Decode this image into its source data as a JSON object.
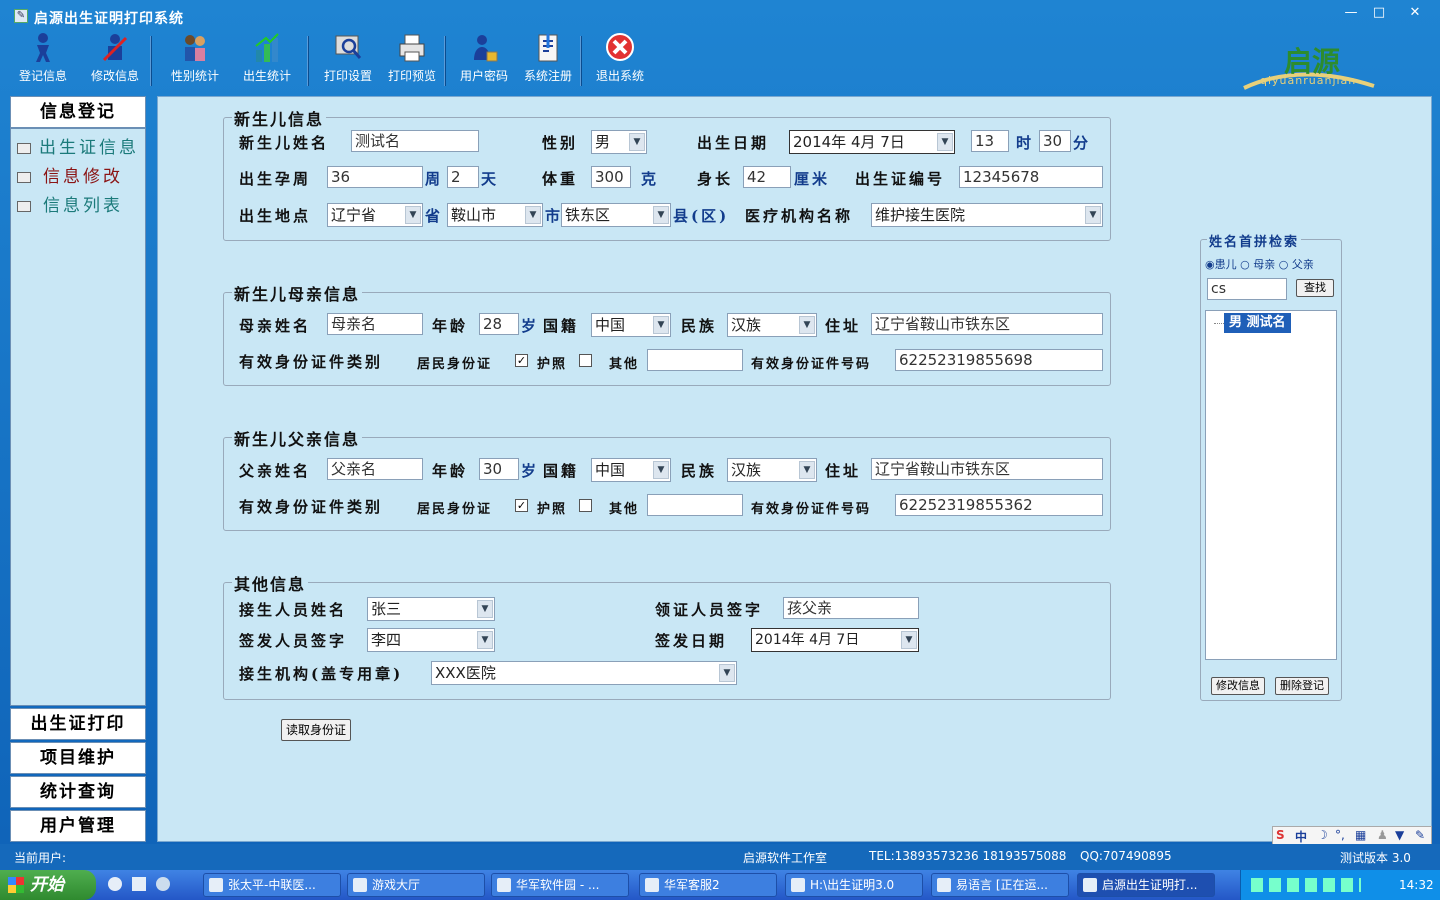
{
  "window": {
    "title": "启源出生证明打印系统",
    "title_icon": "app-icon"
  },
  "toolbar": [
    {
      "label": "登记信息",
      "icon": "register-person-icon"
    },
    {
      "label": "修改信息",
      "icon": "edit-person-icon"
    },
    {
      "label": "性别统计",
      "icon": "gender-stats-icon"
    },
    {
      "label": "出生统计",
      "icon": "birth-stats-icon"
    },
    {
      "label": "打印设置",
      "icon": "print-settings-icon"
    },
    {
      "label": "打印预览",
      "icon": "print-preview-icon"
    },
    {
      "label": "用户密码",
      "icon": "user-password-icon"
    },
    {
      "label": "系统注册",
      "icon": "system-register-icon"
    },
    {
      "label": "退出系统",
      "icon": "exit-icon"
    }
  ],
  "logo": {
    "text": "启源",
    "sub": "qiyuanruanjian"
  },
  "sidebar": {
    "head": "信息登记",
    "items": [
      {
        "label": "出生证信息",
        "color": "#1b7a7a"
      },
      {
        "label": "信息修改",
        "color": "#8b1414"
      },
      {
        "label": "信息列表",
        "color": "#1b7a7a"
      }
    ],
    "bottom": [
      "出生证打印",
      "项目维护",
      "统计查询",
      "用户管理"
    ]
  },
  "baby": {
    "section": "新生儿信息",
    "name_label": "新生儿姓名",
    "name": "测试名",
    "gender_label": "性别",
    "gender": "男",
    "dob_label": "出生日期",
    "dob": "2014年  4月  7日",
    "hour": "13",
    "hour_unit": "时",
    "minute": "30",
    "minute_unit": "分",
    "week_label": "出生孕周",
    "weeks": "36",
    "week_unit": "周",
    "days": "2",
    "day_unit": "天",
    "weight_label": "体重",
    "weight": "300",
    "weight_unit": "克",
    "length_label": "身长",
    "length": "42",
    "length_unit": "厘米",
    "cert_label": "出生证编号",
    "cert_no": "12345678",
    "place_label": "出生地点",
    "province": "辽宁省",
    "province_unit": "省",
    "city": "鞍山市",
    "city_unit": "市",
    "county": "铁东区",
    "county_unit": "县(区)",
    "hospital_label": "医疗机构名称",
    "hospital": "维护接生医院"
  },
  "mother": {
    "section": "新生儿母亲信息",
    "name_label": "母亲姓名",
    "name": "母亲名",
    "age_label": "年龄",
    "age": "28",
    "age_unit": "岁",
    "nation_label": "国籍",
    "nation": "中国",
    "ethnic_label": "民族",
    "ethnic": "汉族",
    "addr_label": "住址",
    "addr": "辽宁省鞍山市铁东区",
    "idtype_label": "有效身份证件类别",
    "id_resident": "居民身份证",
    "id_passport": "护照",
    "id_other": "其他",
    "idno_label": "有效身份证件号码",
    "idno": "62252319855698"
  },
  "father": {
    "section": "新生儿父亲信息",
    "name_label": "父亲姓名",
    "name": "父亲名",
    "age_label": "年龄",
    "age": "30",
    "age_unit": "岁",
    "nation_label": "国籍",
    "nation": "中国",
    "ethnic_label": "民族",
    "ethnic": "汉族",
    "addr_label": "住址",
    "addr": "辽宁省鞍山市铁东区",
    "idtype_label": "有效身份证件类别",
    "id_resident": "居民身份证",
    "id_passport": "护照",
    "id_other": "其他",
    "idno_label": "有效身份证件号码",
    "idno": "62252319855362"
  },
  "other": {
    "section": "其他信息",
    "midwife_label": "接生人员姓名",
    "midwife": "张三",
    "receiver_label": "领证人员签字",
    "receiver": "孩父亲",
    "issuer_label": "签发人员签字",
    "issuer": "李四",
    "issue_date_label": "签发日期",
    "issue_date": "2014年  4月  7日",
    "org_label": "接生机构(盖专用章)",
    "org": "XXX医院"
  },
  "read_id_button": "读取身份证",
  "search": {
    "title": "姓名首拼检索",
    "radio_child": "患儿",
    "radio_mother": "母亲",
    "radio_father": "父亲",
    "query": "cs",
    "find_button": "查找",
    "result": "男  测试名",
    "edit_button": "修改信息",
    "delete_button": "删除登记"
  },
  "status": {
    "user": "当前用户:",
    "studio": "启源软件工作室",
    "tel": "TEL:13893573236  18193575088",
    "qq": "QQ:707490895",
    "version": "测试版本 3.0"
  },
  "ime": {
    "text": "中"
  },
  "taskbar": {
    "start": "开始",
    "tasks": [
      "张太平-中联医...",
      "游戏大厅",
      "华军软件园 - ...",
      "华军客服2",
      "H:\\出生证明3.0",
      "易语言 [正在运...",
      "启源出生证明打..."
    ],
    "clock": "14:32"
  }
}
